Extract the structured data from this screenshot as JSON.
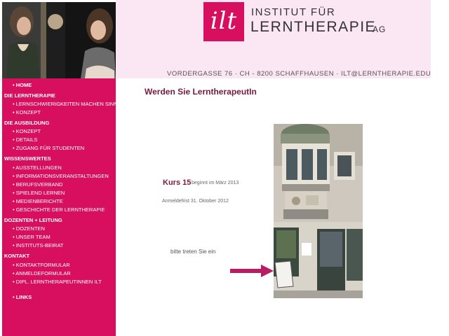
{
  "header": {
    "logo_text": "ilt",
    "brand_line1": "INSTITUT FÜR",
    "brand_line2": "LERNTHERAPIE",
    "brand_suffix": "AG",
    "address": "VORDERGASSE 76  ·  CH - 8200 SCHAFFHAUSEN  · ILT@LERNTHERAPIE.EDU"
  },
  "sidebar": {
    "home": "HOME",
    "section_lerntherapie": "DIE LERNTHERAPIE",
    "lern_1": "LERNSCHWIERIGKEITEN MACHEN SINN",
    "lern_2": "KONZEPT",
    "section_ausbildung": "DIE AUSBILDUNG",
    "aus_1": "KONZEPT",
    "aus_2": "DETAILS",
    "aus_3": "ZUGANG FÜR STUDENTEN",
    "section_wissenswertes": "WISSENSWERTES",
    "wis_1": "AUSSTELLUNGEN",
    "wis_2": "INFORMATIONSVERANSTALTUNGEN",
    "wis_3": "BERUFSVERBAND",
    "wis_4": "SPIELEND LERNEN",
    "wis_5": "MEDIENBERICHTE",
    "wis_6": "GESCHICHTE DER LERNTHERAPIE",
    "section_dozenten": "DOZENTEN + LEITUNG",
    "doz_1": "DOZENTEN",
    "doz_2": "UNSER TEAM",
    "doz_3": "INSTITUTS-BEIRAT",
    "section_kontakt": "KONTAKT",
    "kon_1": "KONTAKTFORMULAR",
    "kon_2": "ANMELDEFORMULAR",
    "kon_3": "DIPL. LERNTHERAPEUTINNEN ILT",
    "links": "LINKS"
  },
  "main": {
    "title": "Werden Sie LerntherapeutIn",
    "course_name": "Kurs 15",
    "course_start": "beginnt im März 2013",
    "deadline": "Anmeldefrist 31. Oktober 2012",
    "enter_text": "bitte treten Sie ein"
  },
  "colors": {
    "brand": "#d80f5f",
    "header_bg": "#fbe6f3",
    "title": "#7a1a3b"
  }
}
